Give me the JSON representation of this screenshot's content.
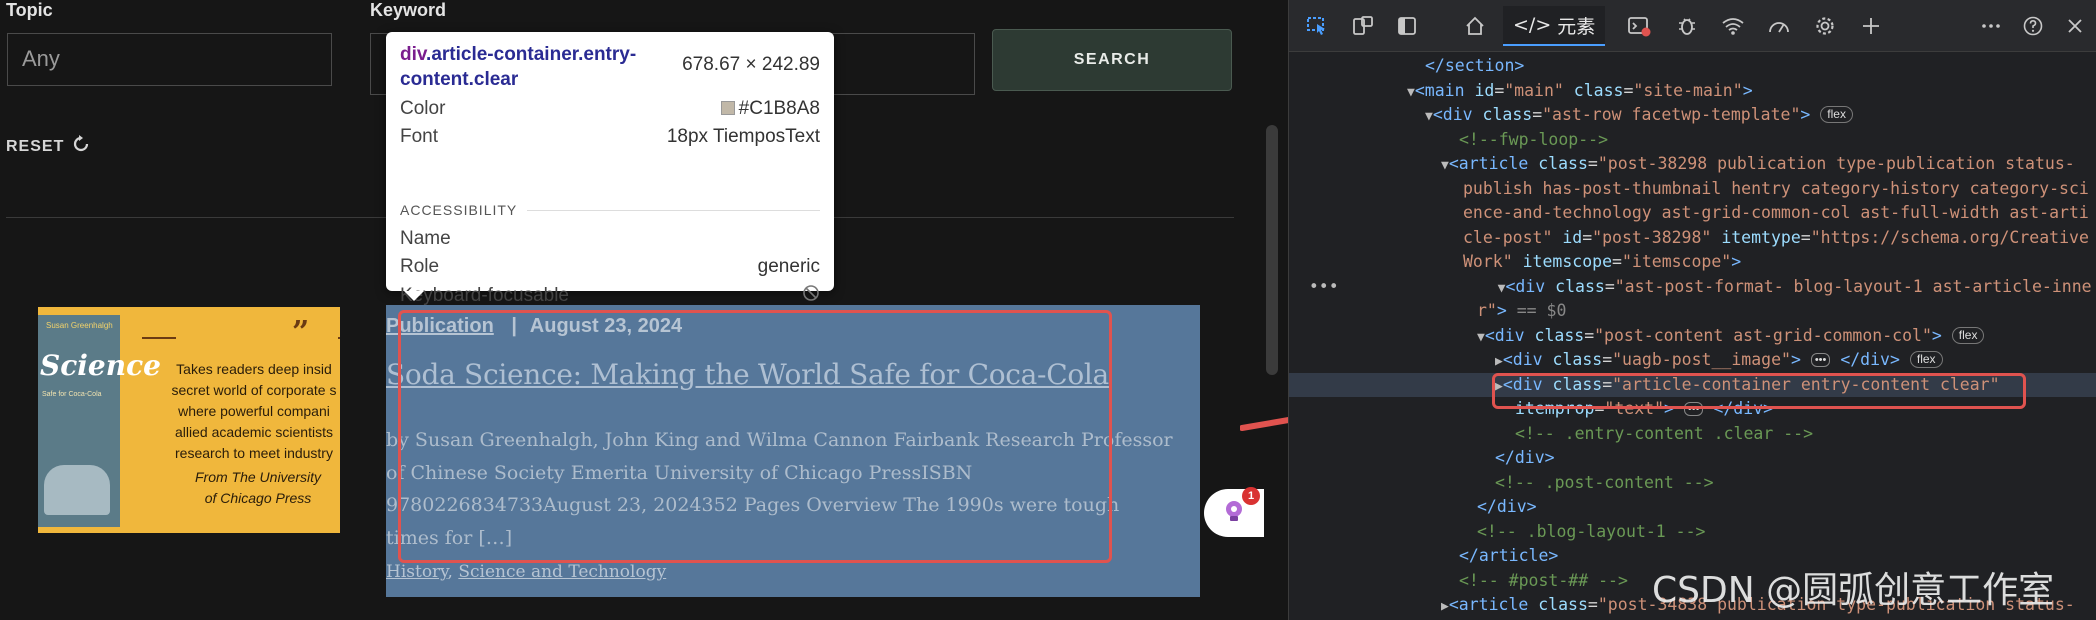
{
  "filters": {
    "topic_label": "Topic",
    "topic_value": "Any",
    "keyword_label": "Keyword",
    "search_label": "SEARCH",
    "reset_label": "RESET"
  },
  "thumbnail": {
    "book_author": "Susan Greenhalgh",
    "book_title": "Science",
    "book_subtitle": "Safe for Coca-Cola",
    "quote_mark": "”",
    "tagline": "Takes readers deep insid\nsecret world of corporate s\nwhere powerful compani\nallied academic scientists\nresearch to meet industry",
    "from": "From The University of Chicago Press"
  },
  "article": {
    "type": "Publication",
    "separator": "|",
    "date": "August 23, 2024",
    "title": "Soda Science: Making the World Safe for Coca-Cola",
    "excerpt": "by Susan Greenhalgh, John King and Wilma Cannon Fairbank Research Professor of Chinese Society Emerita University of Chicago PressISBN 9780226834733August 23, 2024352 Pages Overview The 1990s were tough times for […]",
    "categories": [
      "History",
      "Science and Technology"
    ],
    "cat_sep": ", "
  },
  "tooltip": {
    "tag": "div",
    "selector_classes": ".article-container.entry-content.clear",
    "dimensions": "678.67 × 242.89",
    "color_label": "Color",
    "color_value": "#C1B8A8",
    "font_label": "Font",
    "font_value": "18px TiemposText",
    "section": "ACCESSIBILITY",
    "name_label": "Name",
    "role_label": "Role",
    "role_value": "generic",
    "focus_label": "Keyboard-focusable"
  },
  "badge_count": "1",
  "devtools": {
    "elements_tab": "元素",
    "watermark": "CSDN @圆弧创意工作室"
  },
  "colors": {
    "accent_highlight": "#56779a",
    "annotation_red": "#e0534f",
    "search_button_bg": "#2d3a33"
  }
}
